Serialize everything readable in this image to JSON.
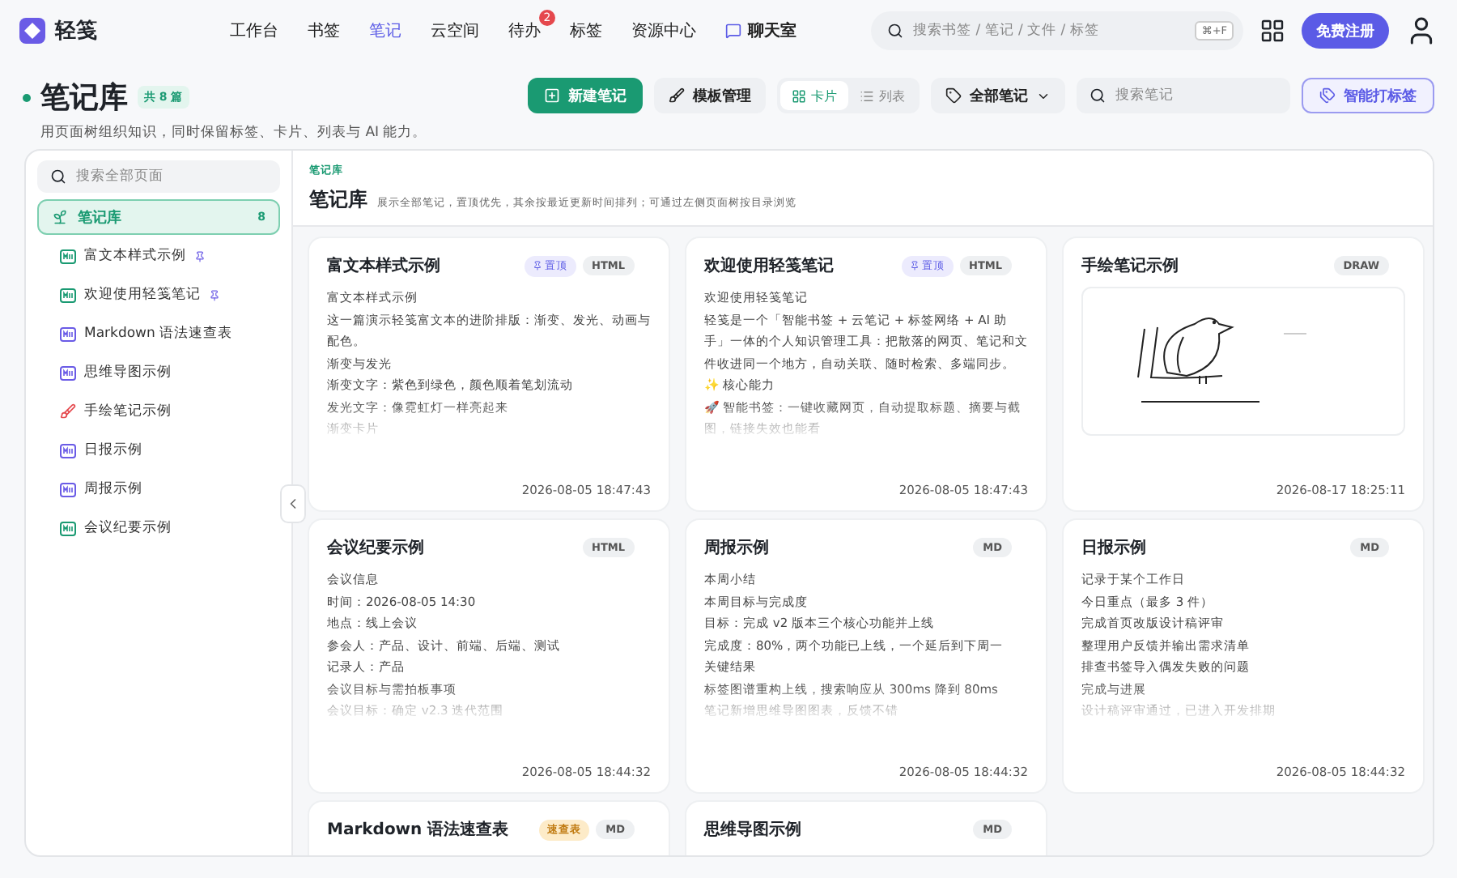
{
  "app": {
    "name": "轻笺"
  },
  "nav": [
    {
      "label": "工作台",
      "selected": false
    },
    {
      "label": "书签",
      "selected": false
    },
    {
      "label": "笔记",
      "selected": true
    },
    {
      "label": "云空间",
      "selected": false
    },
    {
      "label": "待办",
      "selected": false,
      "badge": "2"
    },
    {
      "label": "标签",
      "selected": false
    },
    {
      "label": "资源中心",
      "selected": false
    }
  ],
  "chat": {
    "label": "聊天室"
  },
  "global_search": {
    "placeholder": "搜索书签 / 笔记 / 文件 / 标签",
    "shortcut": "⌘+F"
  },
  "signup": {
    "label": "免费注册"
  },
  "page": {
    "title": "笔记库",
    "count": "共 8 篇",
    "subtitle": "用页面树组织知识，同时保留标签、卡片、列表与 AI 能力。"
  },
  "toolbar": {
    "new_note": "新建笔记",
    "templates": "模板管理",
    "views": [
      {
        "label": "卡片",
        "kind": "grid",
        "selected": true
      },
      {
        "label": "列表",
        "kind": "list",
        "selected": false
      }
    ],
    "filter": "全部笔记",
    "search_placeholder": "搜索笔记",
    "smart_tag": "智能打标签"
  },
  "sidebar": {
    "search_placeholder": "搜索全部页面",
    "root": {
      "label": "笔记库",
      "count": "8",
      "selected": true
    },
    "items": [
      {
        "label": "富文本样式示例",
        "kind": "html",
        "pinned": true
      },
      {
        "label": "欢迎使用轻笺笔记",
        "kind": "html",
        "pinned": true
      },
      {
        "label": "Markdown 语法速查表",
        "kind": "md",
        "pinned": false
      },
      {
        "label": "思维导图示例",
        "kind": "md",
        "pinned": false
      },
      {
        "label": "手绘笔记示例",
        "kind": "draw",
        "pinned": false
      },
      {
        "label": "日报示例",
        "kind": "md",
        "pinned": false
      },
      {
        "label": "周报示例",
        "kind": "md",
        "pinned": false
      },
      {
        "label": "会议纪要示例",
        "kind": "html",
        "pinned": false
      }
    ]
  },
  "content": {
    "breadcrumb": "笔记库",
    "title": "笔记库",
    "description": "展示全部笔记，置顶优先，其余按最近更新时间排列；可通过左侧页面树按目录浏览"
  },
  "cards": [
    {
      "title": "富文本样式示例",
      "kind": "text",
      "pinned": true,
      "pin_label": "置顶",
      "format": "HTML",
      "lines": [
        "富文本样式示例",
        "这一篇演示轻笺富文本的进阶排版：渐变、发光、动画与配色。",
        "渐变与发光",
        "渐变文字：紫色到绿色，颜色顺着笔划流动",
        "发光文字：像霓虹灯一样亮起来",
        "渐变卡片"
      ],
      "time": "2026-08-05 18:47:43"
    },
    {
      "title": "欢迎使用轻笺笔记",
      "kind": "text",
      "pinned": true,
      "pin_label": "置顶",
      "format": "HTML",
      "lines": [
        "欢迎使用轻笺笔记",
        "轻笺是一个「智能书签 + 云笔记 + 标签网络 + AI 助手」一体的个人知识管理工具：把散落的网页、笔记和文件收进同一个地方，自动关联、随时检索、多端同步。",
        "✨ 核心能力",
        "🚀 智能书签：一键收藏网页，自动提取标题、摘要与截图，链接失效也能看"
      ],
      "time": "2026-08-05 18:47:43"
    },
    {
      "title": "手绘笔记示例",
      "kind": "draw",
      "pinned": false,
      "format": "DRAW",
      "time": "2026-08-17 18:25:11"
    },
    {
      "title": "会议纪要示例",
      "kind": "text",
      "pinned": false,
      "format": "HTML",
      "lines": [
        "会议信息",
        "时间：2026-08-05 14:30",
        "地点：线上会议",
        "参会人：产品、设计、前端、后端、测试",
        "记录人：产品",
        "会议目标与需拍板事项",
        "会议目标：确定 v2.3 迭代范围"
      ],
      "time": "2026-08-05 18:44:32"
    },
    {
      "title": "周报示例",
      "kind": "text",
      "pinned": false,
      "format": "MD",
      "lines": [
        "本周小结",
        "本周目标与完成度",
        "目标：完成 v2 版本三个核心功能并上线",
        "完成度：80%，两个功能已上线，一个延后到下周一",
        "关键结果",
        "标签图谱重构上线，搜索响应从 300ms 降到 80ms",
        "笔记新增思维导图图表，反馈不错"
      ],
      "time": "2026-08-05 18:44:32"
    },
    {
      "title": "日报示例",
      "kind": "text",
      "pinned": false,
      "format": "MD",
      "lines": [
        "记录于某个工作日",
        "今日重点（最多 3 件）",
        "完成首页改版设计稿评审",
        "整理用户反馈并输出需求清单",
        "排查书签导入偶发失败的问题",
        "完成与进展",
        "设计稿评审通过，已进入开发排期"
      ],
      "time": "2026-08-05 18:44:32"
    },
    {
      "title": "Markdown 语法速查表",
      "kind": "text",
      "pinned": false,
      "format": "MD",
      "label": "速查表"
    },
    {
      "title": "思维导图示例",
      "kind": "text",
      "pinned": false,
      "format": "MD"
    }
  ]
}
